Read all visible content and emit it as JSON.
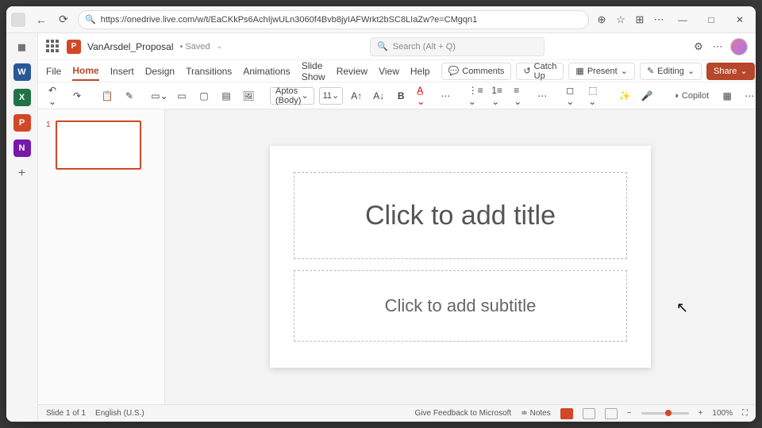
{
  "browser": {
    "url": "https://onedrive.live.com/w/t/EaCKkPs6AchIjwULn3060f4Bvb8jyIAFWrkt2bSC8LIaZw?e=CMgqn1"
  },
  "title": {
    "doc_name": "VanArsdel_Proposal",
    "saved_state": "Saved",
    "search_placeholder": "Search (Alt + Q)"
  },
  "tabs": {
    "file": "File",
    "home": "Home",
    "insert": "Insert",
    "design": "Design",
    "transitions": "Transitions",
    "animations": "Animations",
    "slideshow": "Slide Show",
    "review": "Review",
    "view": "View",
    "help": "Help"
  },
  "actions": {
    "comments": "Comments",
    "catchup": "Catch Up",
    "present": "Present",
    "editing": "Editing",
    "share": "Share"
  },
  "toolbar": {
    "font": "Aptos (Body)",
    "size": "11",
    "bold": "B",
    "copilot": "Copilot"
  },
  "thumbs": {
    "slide1_num": "1"
  },
  "slide": {
    "title_placeholder": "Click to add title",
    "subtitle_placeholder": "Click to add subtitle"
  },
  "status": {
    "slide_info": "Slide 1 of 1",
    "language": "English (U.S.)",
    "feedback": "Give Feedback to Microsoft",
    "notes": "Notes",
    "zoom": "100%"
  }
}
